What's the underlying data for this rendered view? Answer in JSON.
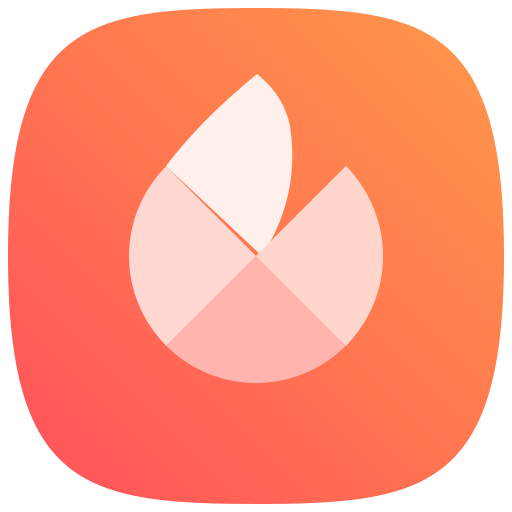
{
  "icon": {
    "name": "flame-app-icon",
    "semantic": "flame-icon",
    "colors": {
      "gradient_top_right": "#FF9A4A",
      "gradient_mid": "#FF7650",
      "gradient_bottom_left": "#FF4F5C",
      "flame_top_petal": "#FFF0EC",
      "flame_left_petal": "#FFD7D1",
      "flame_right_petal": "#FFD5CC",
      "flame_bottom_petal": "#FFB5AE"
    }
  }
}
